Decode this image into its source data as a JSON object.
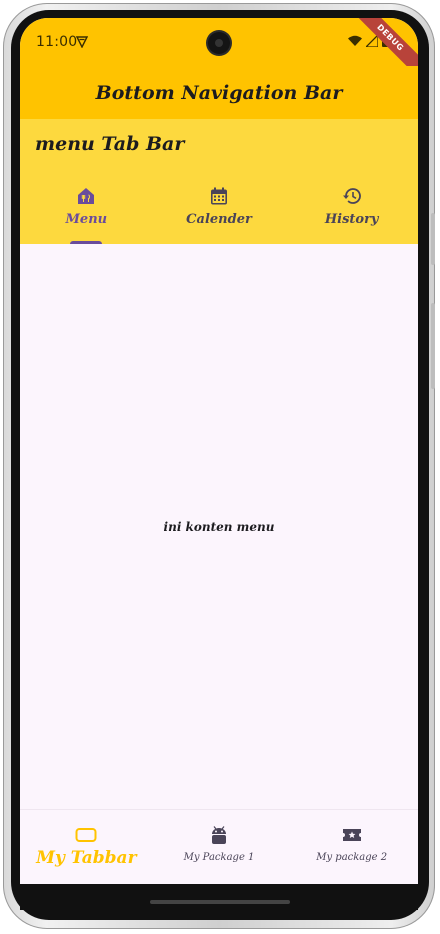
{
  "status_bar": {
    "time": "11:00",
    "debug_label": "DEBUG"
  },
  "app_bar": {
    "title": "Bottom Navigation Bar"
  },
  "tab_bar": {
    "title": "menu Tab Bar",
    "tabs": [
      {
        "label": "Menu",
        "icon": "menu-restaurant-icon",
        "active": true
      },
      {
        "label": "Calender",
        "icon": "calendar-icon",
        "active": false
      },
      {
        "label": "History",
        "icon": "history-icon",
        "active": false
      }
    ]
  },
  "content": {
    "text": "ini konten menu"
  },
  "bottom_nav": {
    "items": [
      {
        "label": "My Tabbar",
        "icon": "tablet-icon",
        "active": true
      },
      {
        "label": "My Package 1",
        "icon": "android-icon",
        "active": false
      },
      {
        "label": "My package 2",
        "icon": "local-activity-icon",
        "active": false
      }
    ]
  },
  "colors": {
    "app_bar": "#ffc300",
    "tab_bar": "#fdd93e",
    "accent": "#6a4c9c",
    "background": "#fcf5fd"
  }
}
